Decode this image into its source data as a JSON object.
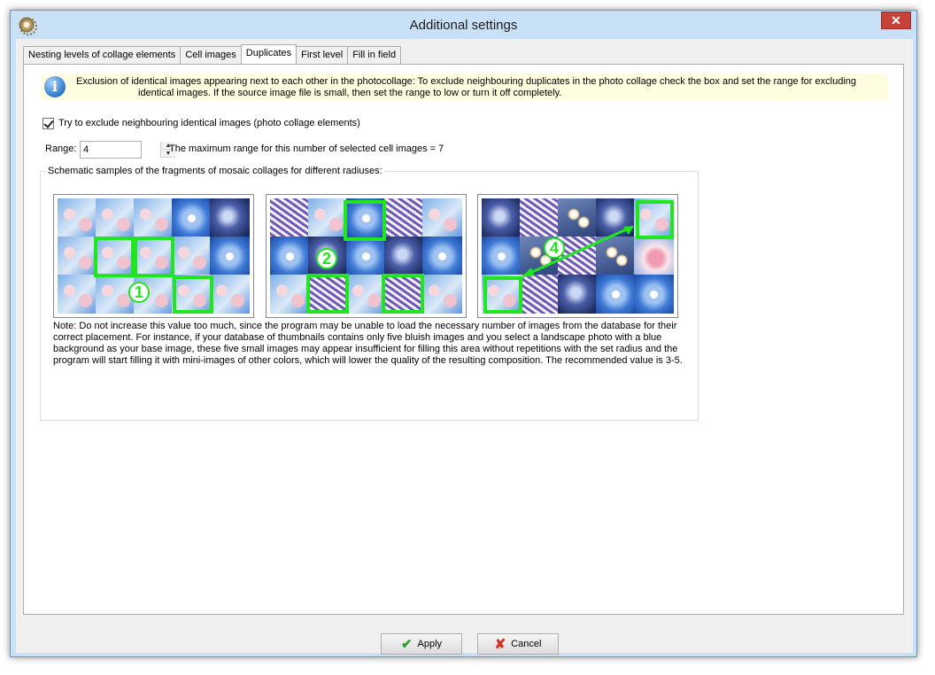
{
  "window": {
    "title": "Additional settings"
  },
  "tabs": [
    {
      "label": "Nesting levels of collage elements"
    },
    {
      "label": "Cell images"
    },
    {
      "label": "Duplicates"
    },
    {
      "label": "First level"
    },
    {
      "label": "Fill in field"
    }
  ],
  "info": {
    "line1": "Exclusion of identical images appearing next to each other in the photocollage: To exclude neighbouring duplicates in the photo collage check the box and set the range for excluding",
    "line2": "identical images. If the source image file is small, then set the range to low or turn it off completely."
  },
  "checkbox": {
    "label": "Try to exclude neighbouring identical images (photo collage elements)",
    "checked": true
  },
  "range": {
    "label": "Range:",
    "value": "4",
    "note": "The maximum range for this number of selected cell images = 7"
  },
  "samples": {
    "legend": "Schematic samples of the fragments of mosaic collages for different radiuses:",
    "numbers": [
      "1",
      "2",
      "4"
    ]
  },
  "note": "Note: Do not increase this value too much, since the program may be unable to load the necessary number of images from the database for their correct placement. For instance, if your database of thumbnails contains only five bluish images and you select a landscape photo with a blue background as your base image, these five small images may appear insufficient for filling this area without repetitions with the set radius and the program will start filling it with mini-images of other colors, which will lower the quality of the resulting composition. The recommended value is 3-5.",
  "buttons": {
    "apply": "Apply",
    "cancel": "Cancel"
  },
  "colors": {
    "highlight": "#1fe61f",
    "info_bg": "#fefde0"
  }
}
